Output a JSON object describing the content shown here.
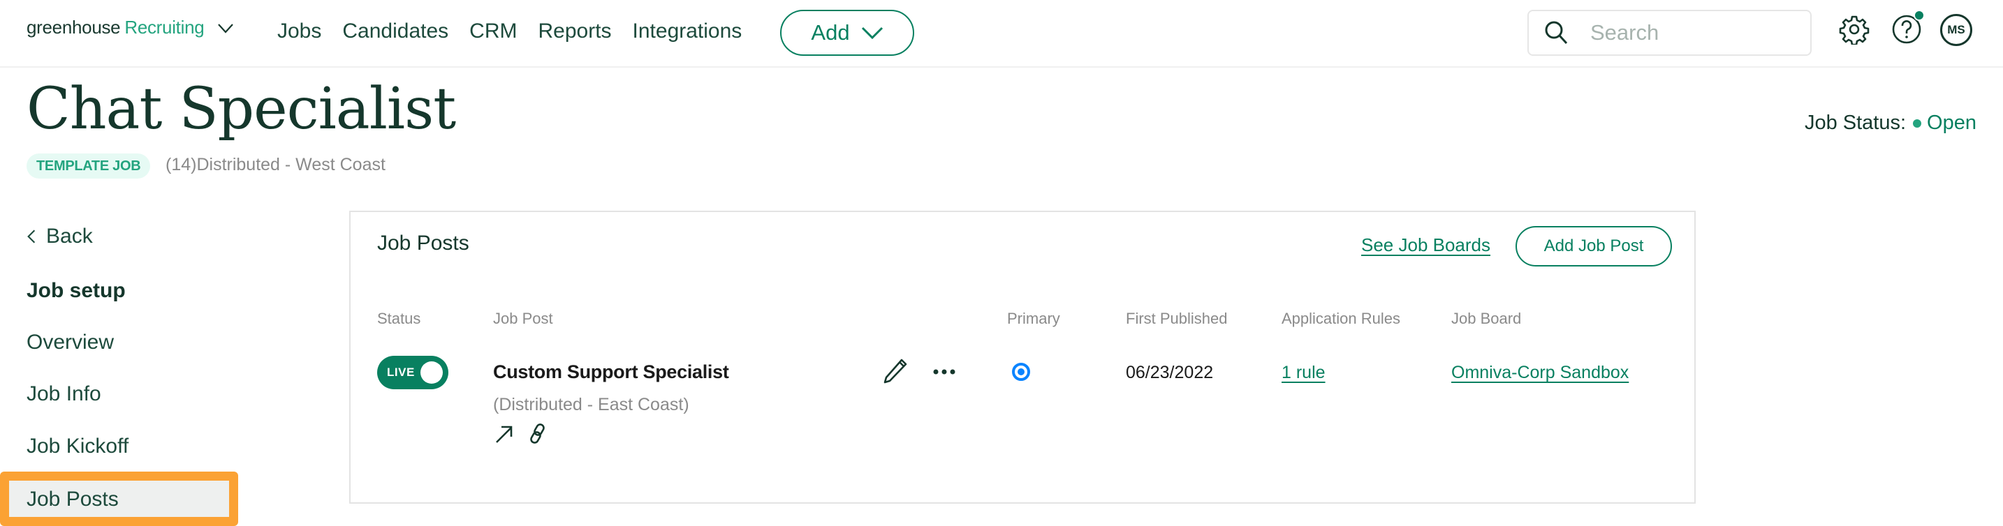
{
  "topnav": {
    "logo_part1": "greenhouse",
    "logo_part2": "Recruiting",
    "links": [
      "Jobs",
      "Candidates",
      "CRM",
      "Reports",
      "Integrations"
    ],
    "add_label": "Add",
    "search_placeholder": "Search",
    "avatar_initials": "MS",
    "icons": [
      "chevron-down-icon",
      "search-icon",
      "gear-icon",
      "help-icon",
      "notification-dot"
    ]
  },
  "header": {
    "title": "Chat Specialist",
    "badge": "TEMPLATE JOB",
    "location": "(14)Distributed - West Coast",
    "status_label": "Job Status:",
    "status_value": "Open"
  },
  "sidebar": {
    "back_label": "Back",
    "section_heading": "Job setup",
    "items": [
      "Overview",
      "Job Info",
      "Job Kickoff",
      "Job Posts"
    ],
    "active_item": "Job Posts"
  },
  "card": {
    "title": "Job Posts",
    "see_boards_label": "See Job Boards",
    "add_post_label": "Add Job Post",
    "columns": [
      "Status",
      "Job Post",
      "Primary",
      "First Published",
      "Application Rules",
      "Job Board"
    ],
    "rows": [
      {
        "status": "LIVE",
        "status_on": true,
        "name": "Custom Support Specialist",
        "location": "(Distributed - East Coast)",
        "primary": true,
        "first_published": "06/23/2022",
        "rules": "1 rule",
        "job_board": "Omniva-Corp Sandbox"
      }
    ]
  },
  "colors": {
    "brand_green": "#088060",
    "accent_green": "#24a47f",
    "text_dark": "#15372c",
    "highlight_orange": "#fba234",
    "radio_blue": "#0a84ff"
  }
}
